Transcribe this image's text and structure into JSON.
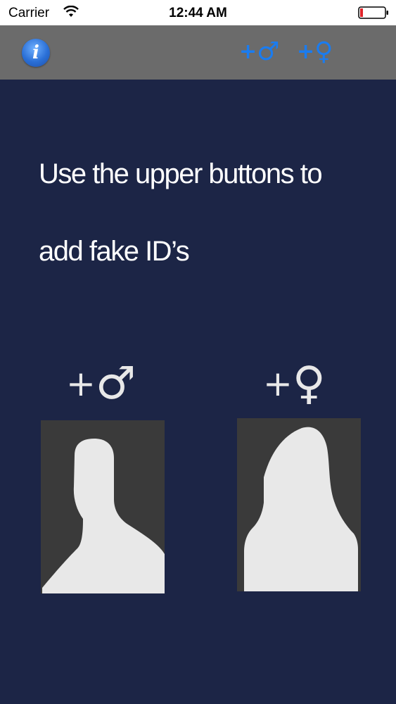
{
  "status_bar": {
    "carrier": "Carrier",
    "time": "12:44 AM",
    "wifi_icon": "wifi-icon",
    "battery_icon": "battery-low-icon",
    "battery_color": "#e0252b"
  },
  "nav_bar": {
    "info_label": "i",
    "info_icon": "info-icon",
    "add_male": {
      "plus": "+",
      "symbol": "♂"
    },
    "add_female": {
      "plus": "+",
      "symbol": "♀"
    },
    "accent_color": "#1a7cf0",
    "background_color": "#6b6b6b"
  },
  "main": {
    "instruction_line1": "Use the upper buttons to",
    "instruction_line2": "add fake ID’s",
    "male_label": {
      "plus": "+",
      "symbol": "♂"
    },
    "female_label": {
      "plus": "+",
      "symbol": "♀"
    },
    "male_avatar_icon": "male-silhouette-icon",
    "female_avatar_icon": "female-silhouette-icon",
    "background_color": "#1c2546"
  }
}
